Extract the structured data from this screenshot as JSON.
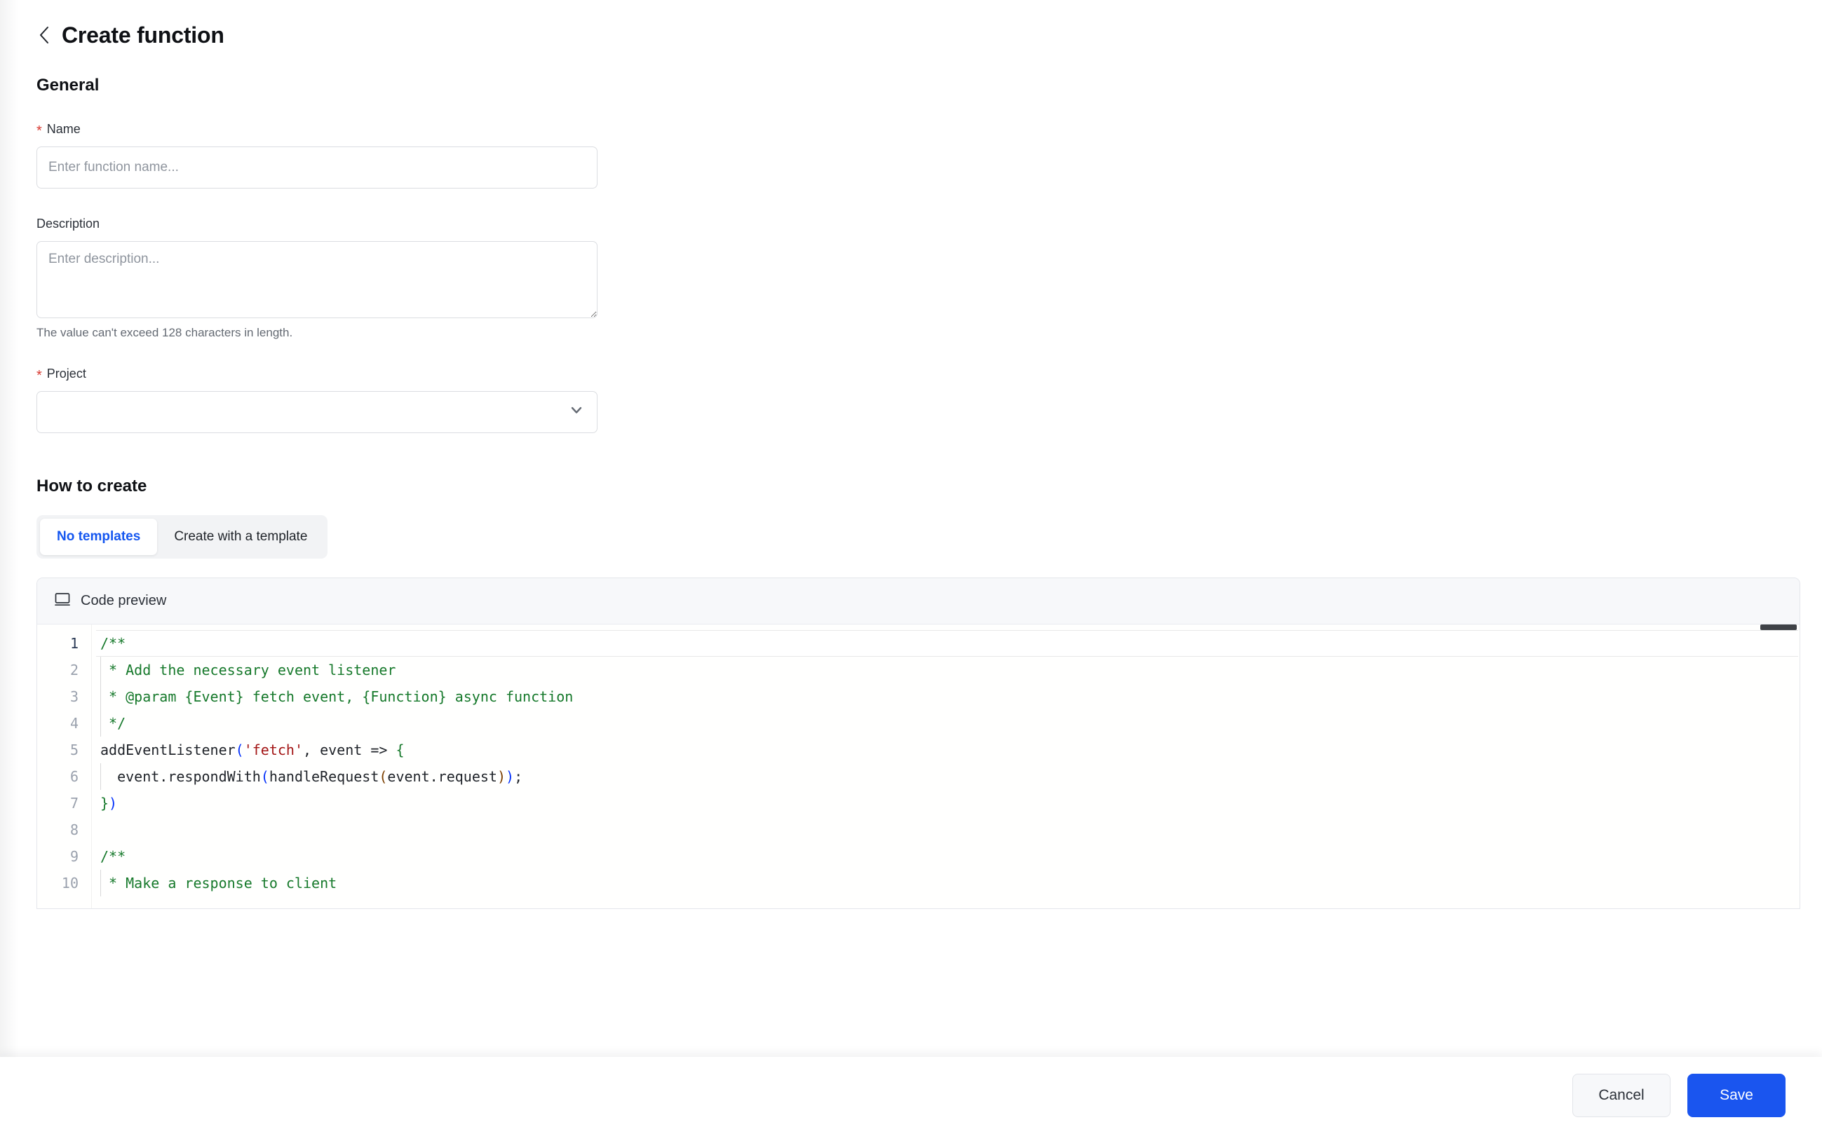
{
  "header": {
    "back_icon": "chevron-left-icon",
    "title": "Create function"
  },
  "general": {
    "section_title": "General",
    "name": {
      "label": "Name",
      "required_marker": "*",
      "value": "",
      "placeholder": "Enter function name..."
    },
    "description": {
      "label": "Description",
      "value": "",
      "placeholder": "Enter description...",
      "helper": "The value can't exceed 128 characters in length."
    },
    "project": {
      "label": "Project",
      "required_marker": "*",
      "value": "",
      "chevron_icon": "chevron-down-icon"
    }
  },
  "how_to_create": {
    "section_title": "How to create",
    "tabs": [
      {
        "label": "No templates",
        "active": true
      },
      {
        "label": "Create with a template",
        "active": false
      }
    ]
  },
  "code_preview": {
    "icon": "monitor-icon",
    "title": "Code preview",
    "language": "javascript",
    "active_line": 1,
    "lines": [
      {
        "n": "1",
        "text": "/**"
      },
      {
        "n": "2",
        "text": " * Add the necessary event listener"
      },
      {
        "n": "3",
        "text": " * @param {Event} fetch event, {Function} async function"
      },
      {
        "n": "4",
        "text": " */"
      },
      {
        "n": "5",
        "text": "addEventListener('fetch', event => {"
      },
      {
        "n": "6",
        "text": "  event.respondWith(handleRequest(event.request));"
      },
      {
        "n": "7",
        "text": "})"
      },
      {
        "n": "8",
        "text": ""
      },
      {
        "n": "9",
        "text": "/**"
      },
      {
        "n": "10",
        "text": " * Make a response to client"
      }
    ]
  },
  "footer": {
    "cancel_label": "Cancel",
    "save_label": "Save"
  },
  "colors": {
    "accent_blue": "#1a55ef",
    "tab_active_text": "#1456f0",
    "required_red": "#d83931",
    "comment_green": "#16792b",
    "string_red": "#a31515",
    "bracket_blue": "#0431fa",
    "bracket_orange": "#7b3f00",
    "border": "#dbdde1",
    "muted_text": "#646a73",
    "placeholder": "#8f959e"
  }
}
